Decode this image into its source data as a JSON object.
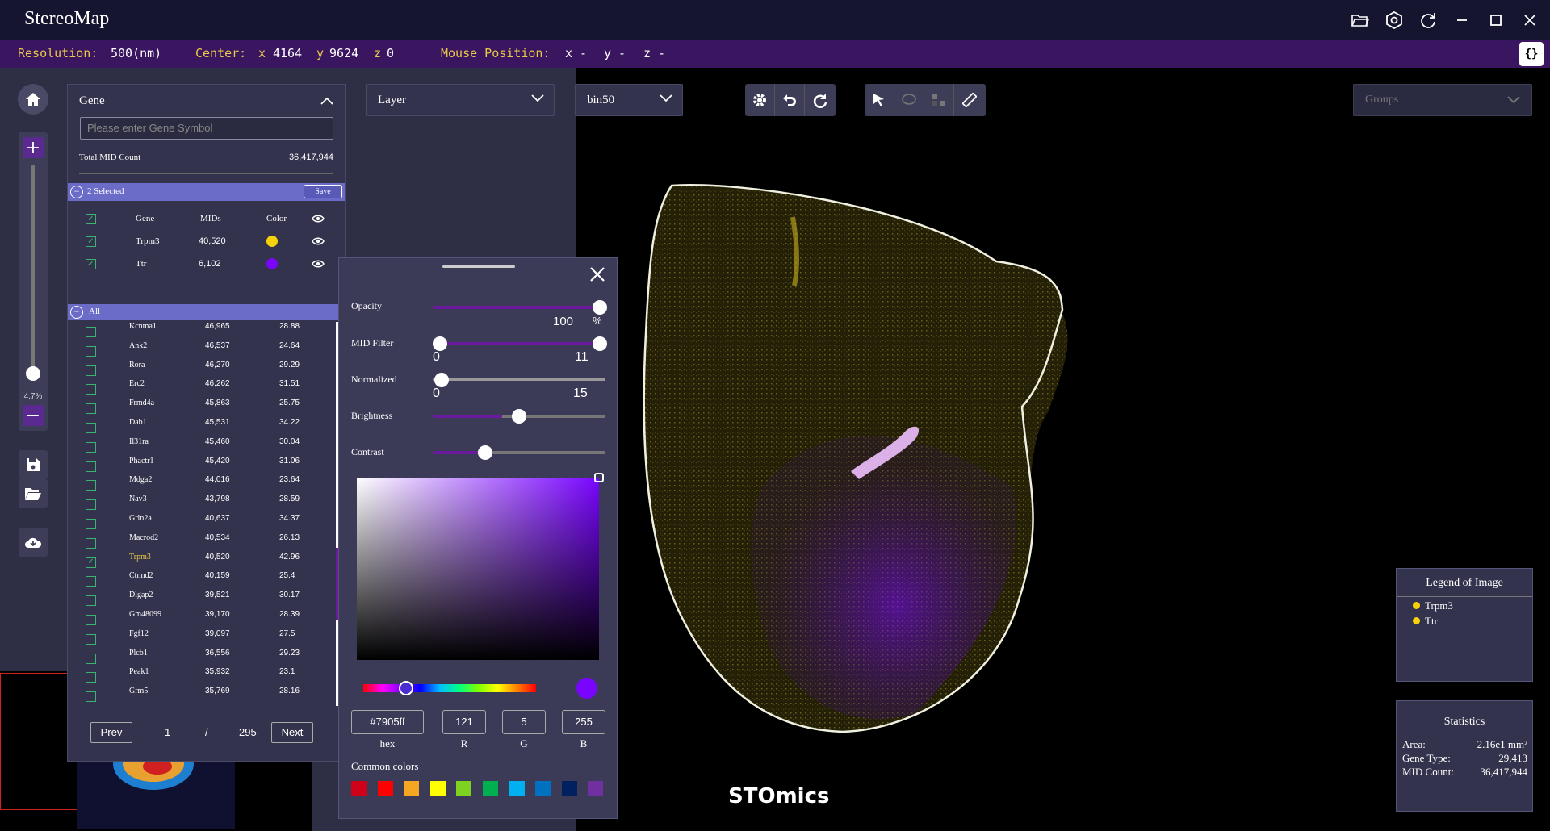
{
  "app": {
    "title": "StereoMap"
  },
  "titlebar_icons": [
    "folder-open-icon",
    "settings-icon",
    "refresh-icon",
    "minimize-icon",
    "maximize-icon",
    "close-icon"
  ],
  "status": {
    "resolution_label": "Resolution:",
    "resolution_value": "500(nm)",
    "center_label": "Center:",
    "center_x_label": "x",
    "center_x": "4164",
    "center_y_label": "y",
    "center_y": "9624",
    "center_z_label": "z",
    "center_z": "0",
    "mouse_label": "Mouse Position:",
    "mouse_x": "x -",
    "mouse_y": "y -",
    "mouse_z": "z -",
    "code_button": "{}"
  },
  "zoom": {
    "percent": "4.7%",
    "level": 0.047,
    "plus": "+",
    "minus": "−"
  },
  "gene_panel": {
    "title": "Gene",
    "search_placeholder": "Please enter Gene Symbol",
    "total_label": "Total MID Count",
    "total_value": "36,417,944",
    "selected_label": "2 Selected",
    "save_label": "Save",
    "columns": {
      "gene": "Gene",
      "mids": "MIDs",
      "color": "Color"
    },
    "selected": [
      {
        "gene": "Trpm3",
        "mids": "40,520",
        "color": "#f5d20a"
      },
      {
        "gene": "Ttr",
        "mids": "6,102",
        "color": "#7905ff"
      }
    ],
    "all_label": "All",
    "genes": [
      {
        "name": "Kcnma1",
        "mids": "46,965",
        "pct": "28.88",
        "checked": false
      },
      {
        "name": "Ank2",
        "mids": "46,537",
        "pct": "24.64",
        "checked": false
      },
      {
        "name": "Rora",
        "mids": "46,270",
        "pct": "29.29",
        "checked": false
      },
      {
        "name": "Erc2",
        "mids": "46,262",
        "pct": "31.51",
        "checked": false
      },
      {
        "name": "Frmd4a",
        "mids": "45,863",
        "pct": "25.75",
        "checked": false
      },
      {
        "name": "Dab1",
        "mids": "45,531",
        "pct": "34.22",
        "checked": false
      },
      {
        "name": "Il31ra",
        "mids": "45,460",
        "pct": "30.04",
        "checked": false
      },
      {
        "name": "Phactr1",
        "mids": "45,420",
        "pct": "31.06",
        "checked": false
      },
      {
        "name": "Mdga2",
        "mids": "44,016",
        "pct": "23.64",
        "checked": false
      },
      {
        "name": "Nav3",
        "mids": "43,798",
        "pct": "28.59",
        "checked": false
      },
      {
        "name": "Grin2a",
        "mids": "40,637",
        "pct": "34.37",
        "checked": false
      },
      {
        "name": "Macrod2",
        "mids": "40,534",
        "pct": "26.13",
        "checked": false
      },
      {
        "name": "Trpm3",
        "mids": "40,520",
        "pct": "42.96",
        "checked": true
      },
      {
        "name": "Ctnnd2",
        "mids": "40,159",
        "pct": "25.4",
        "checked": false
      },
      {
        "name": "Dlgap2",
        "mids": "39,521",
        "pct": "30.17",
        "checked": false
      },
      {
        "name": "Gm48099",
        "mids": "39,170",
        "pct": "28.39",
        "checked": false
      },
      {
        "name": "Fgf12",
        "mids": "39,097",
        "pct": "27.5",
        "checked": false
      },
      {
        "name": "Plcb1",
        "mids": "36,556",
        "pct": "29.23",
        "checked": false
      },
      {
        "name": "Peak1",
        "mids": "35,932",
        "pct": "23.1",
        "checked": false
      },
      {
        "name": "Grm5",
        "mids": "35,769",
        "pct": "28.16",
        "checked": false
      }
    ],
    "pager": {
      "prev": "Prev",
      "page": "1",
      "sep": "/",
      "total": "295",
      "next": "Next"
    }
  },
  "dropdowns": {
    "layer": "Layer",
    "bin": "bin50",
    "groups": "Groups"
  },
  "toolbar_icons": {
    "group1": [
      "gear-icon",
      "undo-icon",
      "redo-icon"
    ],
    "group2": [
      "pointer-icon",
      "lasso-icon",
      "grid-select-icon",
      "ruler-icon"
    ]
  },
  "color_popup": {
    "opacity_label": "Opacity",
    "opacity_value": "100",
    "opacity_unit": "%",
    "opacity_level": 1.0,
    "mid_filter_label": "MID Filter",
    "mid_filter_min": "0",
    "mid_filter_max": "11",
    "normalized_label": "Normalized",
    "normalized_min": "0",
    "normalized_max": "15",
    "brightness_label": "Brightness",
    "brightness_level": 0.4,
    "contrast_label": "Contrast",
    "contrast_level": 0.26,
    "hex": "#7905ff",
    "r": "121",
    "g": "5",
    "b": "255",
    "hex_label": "hex",
    "r_label": "R",
    "g_label": "G",
    "b_label": "B",
    "common_label": "Common colors",
    "common_colors": [
      "#d0021b",
      "#ff0000",
      "#f5a623",
      "#ffff00",
      "#7ed321",
      "#00b050",
      "#00b0f0",
      "#0070c0",
      "#002060",
      "#7030a0"
    ]
  },
  "legend": {
    "title": "Legend of Image",
    "items": [
      {
        "name": "Trpm3",
        "color": "#f5d20a"
      },
      {
        "name": "Ttr",
        "color": "#f5d20a"
      }
    ]
  },
  "stats": {
    "title": "Statistics",
    "area_label": "Area:",
    "area_value": "2.16e1 mm²",
    "gene_type_label": "Gene Type:",
    "gene_type_value": "29,413",
    "mid_label": "MID Count:",
    "mid_value": "36,417,944"
  },
  "brand": "STOmics"
}
